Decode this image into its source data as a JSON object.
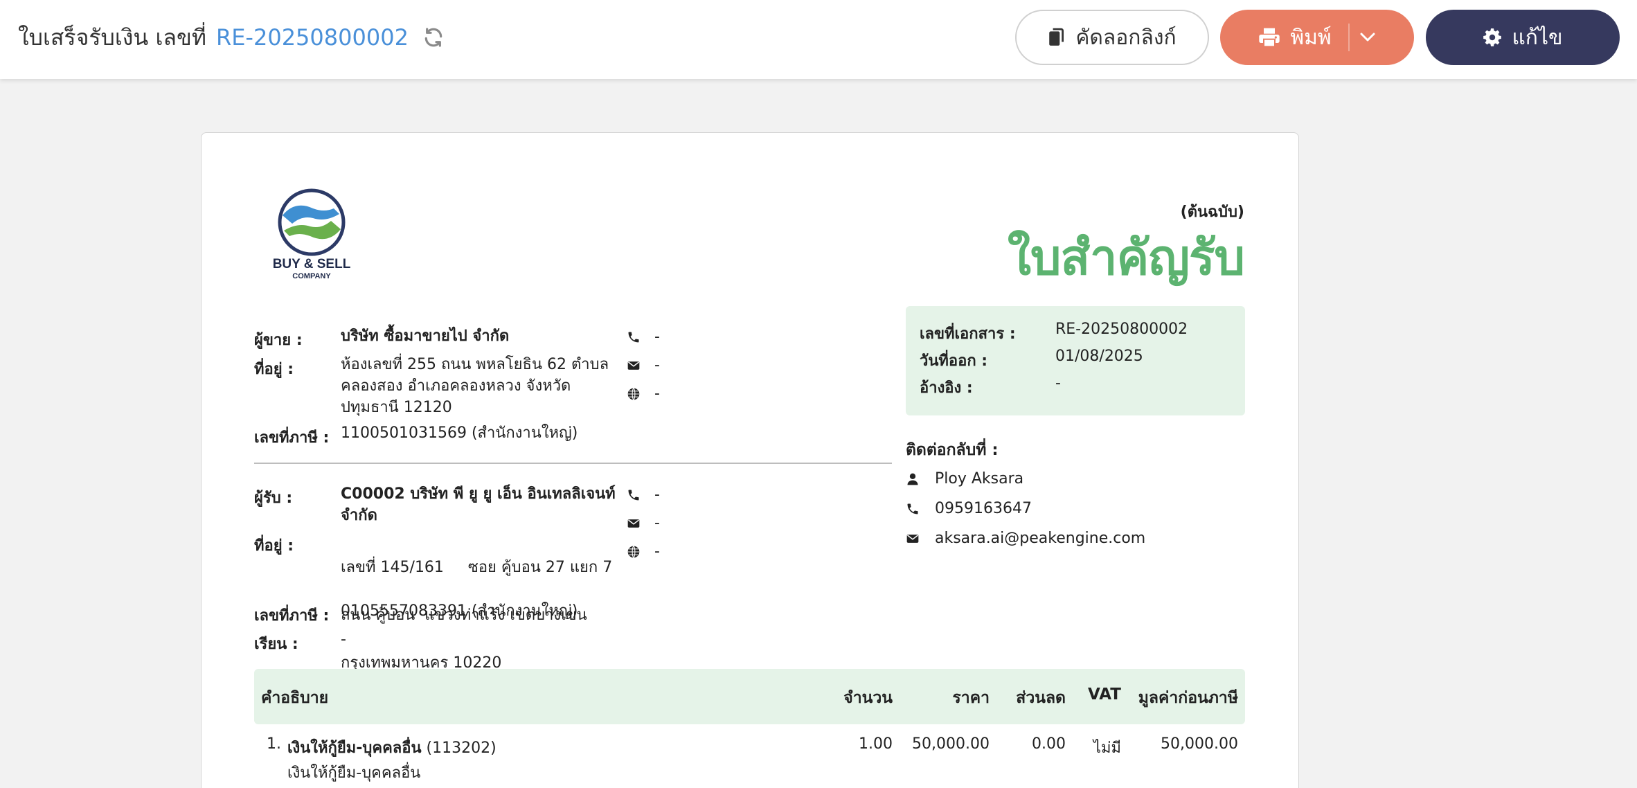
{
  "header": {
    "title": "ใบเสร็จรับเงิน เลขที่",
    "doc_number": "RE-20250800002",
    "buttons": {
      "copy_link": "คัดลอกลิงก์",
      "print": "พิมพ์",
      "edit": "แก้ไข"
    }
  },
  "document": {
    "logo": {
      "line1": "BUY & SELL",
      "line2": "COMPANY"
    },
    "copy_label": "(ต้นฉบับ)",
    "title": "ใบสำคัญรับ",
    "seller": {
      "label": "ผู้ขาย :",
      "name": "บริษัท ซื้อมาขายไป จำกัด",
      "address_label": "ที่อยู่ :",
      "address_lines": [
        "ห้องเลขที่ 255 ถนน พหลโยธิน 62 ตำบล",
        "คลองสอง อำเภอคลองหลวง จังหวัด",
        "ปทุมธานี 12120"
      ],
      "tax_label": "เลขที่ภาษี :",
      "tax_id": "1100501031569 (สำนักงานใหญ่)",
      "phone": "-",
      "email": "-",
      "web": "-"
    },
    "receiver": {
      "label": "ผู้รับ :",
      "name_lines": [
        "C00002 บริษัท พี ยู ยู เอ็น อินเทลลิเจนท์",
        "จำกัด"
      ],
      "address_label": "ที่อยู่ :",
      "address_lines": [
        "เลขที่ 145/161     ซอย คู้บอน 27 แยก 7",
        "ถนน คู้บอน  แขวงท่าแร้ง เขตบางเขน",
        "กรุงเทพมหานคร 10220"
      ],
      "tax_label": "เลขที่ภาษี :",
      "tax_id": "0105557083391 (สำนักงานใหญ่)",
      "attn_label": "เรียน :",
      "attn": "-",
      "phone": "-",
      "email": "-",
      "web": "-"
    },
    "info": {
      "doc_no_label": "เลขที่เอกสาร :",
      "doc_no": "RE-20250800002",
      "issue_date_label": "วันที่ออก :",
      "issue_date": "01/08/2025",
      "ref_label": "อ้างอิง :",
      "ref": "-"
    },
    "contact": {
      "heading": "ติดต่อกลับที่ :",
      "name": "Ploy Aksara",
      "phone": "0959163647",
      "email": "aksara.ai@peakengine.com"
    },
    "table": {
      "headers": {
        "description": "คำอธิบาย",
        "qty": "จำนวน",
        "price": "ราคา",
        "discount": "ส่วนลด",
        "vat": "VAT",
        "amount": "มูลค่าก่อนภาษี"
      },
      "rows": [
        {
          "no": "1.",
          "title": "เงินให้กู้ยืม-บุคคลอื่น",
          "code": "(113202)",
          "subtitle": "เงินให้กู้ยืม-บุคคลอื่น",
          "qty": "1.00",
          "price": "50,000.00",
          "discount": "0.00",
          "vat": "ไม่มี",
          "amount": "50,000.00"
        }
      ]
    }
  },
  "colors": {
    "accent_link": "#4a90d9",
    "print_button": "#e97d63",
    "edit_button": "#36395e",
    "title_green": "#5cb370",
    "panel_green": "#e5f3e8"
  }
}
